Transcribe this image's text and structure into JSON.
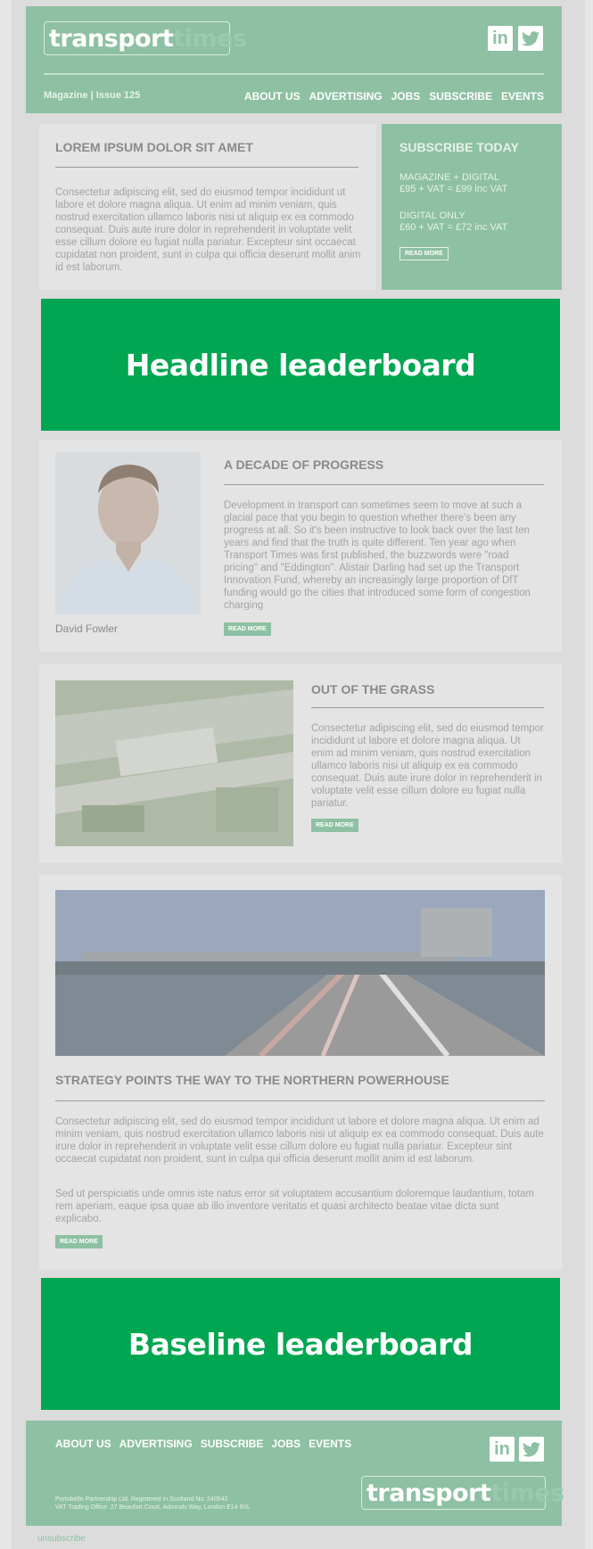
{
  "header": {
    "logo_part1": "transport",
    "logo_part2": "times",
    "linkedin": "in",
    "twitter": "t",
    "issue": "Magazine | Issue 125",
    "nav": [
      "ABOUT US",
      "ADVERTISING",
      "JOBS",
      "SUBSCRIBE",
      "EVENTS"
    ]
  },
  "intro": {
    "title": "LOREM IPSUM DOLOR SIT AMET",
    "body": "Consectetur adipiscing elit, sed do eiusmod tempor incididunt ut labore et dolore magna aliqua. Ut enim ad minim veniam, quis nostrud exercitation ullamco laboris nisi ut aliquip ex ea commodo consequat. Duis aute irure dolor in reprehenderit in voluptate velit esse cillum dolore eu fugiat nulla pariatur. Excepteur sint occaecat cupidatat non proident, sunt in culpa qui officia deserunt mollit anim id est laborum."
  },
  "subscribe": {
    "title": "SUBSCRIBE TODAY",
    "option1_name": "MAGAZINE + DIGITAL",
    "option1_price": "£95 + VAT = £99 inc VAT",
    "option2_name": "DIGITAL ONLY",
    "option2_price": "£60 + VAT = £72 inc VAT",
    "button": "READ MORE"
  },
  "ads": {
    "headline": "Headline leaderboard",
    "baseline": "Baseline leaderboard"
  },
  "articles": [
    {
      "title": "A DECADE OF PROGRESS",
      "body": "Development in transport can sometimes seem to move at such a glacial pace that you begin to question whether there's been any progress at all. So it's been instructive to look back over the last ten years and find that the truth is quite different. Ten year ago when Transport Times was first published, the buzzwords were \"road pricing\" and \"Eddington\". Alistair Darling had set up the Transport Innovation Fund, whereby an increasingly large proportion of DfT funding would go the cities that introduced some form of congestion charging",
      "caption": "David Fowler",
      "button": "READ MORE"
    },
    {
      "title": "OUT OF THE GRASS",
      "body": "Consectetur adipiscing elit, sed do eiusmod tempor incididunt ut labore et dolore magna aliqua. Ut enim ad minim veniam, quis nostrud exercitation ullamco laboris nisi ut aliquip ex ea commodo consequat. Duis aute irure dolor in reprehenderit in voluptate velit esse cillum dolore eu fugiat nulla pariatur.",
      "button": "READ MORE"
    },
    {
      "title": "STRATEGY POINTS THE WAY TO THE NORTHERN POWERHOUSE",
      "body1": "Consectetur adipiscing elit, sed do eiusmod tempor incididunt ut labore et dolore magna aliqua. Ut enim ad minim veniam, quis nostrud exercitation ullamco laboris nisi ut aliquip ex ea commodo consequat. Duis aute irure dolor in reprehenderit in voluptate velit esse cillum dolore eu fugiat nulla pariatur. Excepteur sint occaecat cupidatat non proident, sunt in culpa qui officia deserunt mollit anim id est laborum.",
      "body2": "Sed ut perspiciatis unde omnis iste natus error sit voluptatem accusantium doloremque laudantium, totam rem aperiam, eaque ipsa quae ab illo inventore veritatis et quasi architecto beatae vitae dicta sunt explicabo.",
      "button": "READ MORE"
    }
  ],
  "footer": {
    "nav": [
      "ABOUT US",
      "ADVERTISING",
      "SUBSCRIBE",
      "JOBS",
      "EVENTS"
    ],
    "linkedin": "in",
    "twitter": "t",
    "legal1": "Portobello Partnership Ltd. Registered in Scotland No: 240542",
    "legal2": "VAT Trading Office: 27 Beaufort Court, Admirals Way, London E14 9XL",
    "logo_part1": "transport",
    "logo_part2": "times",
    "unsubscribe": "unsubscribe"
  },
  "colors": {
    "brand_green": "#8ec0a3",
    "ad_green": "#00a651"
  }
}
